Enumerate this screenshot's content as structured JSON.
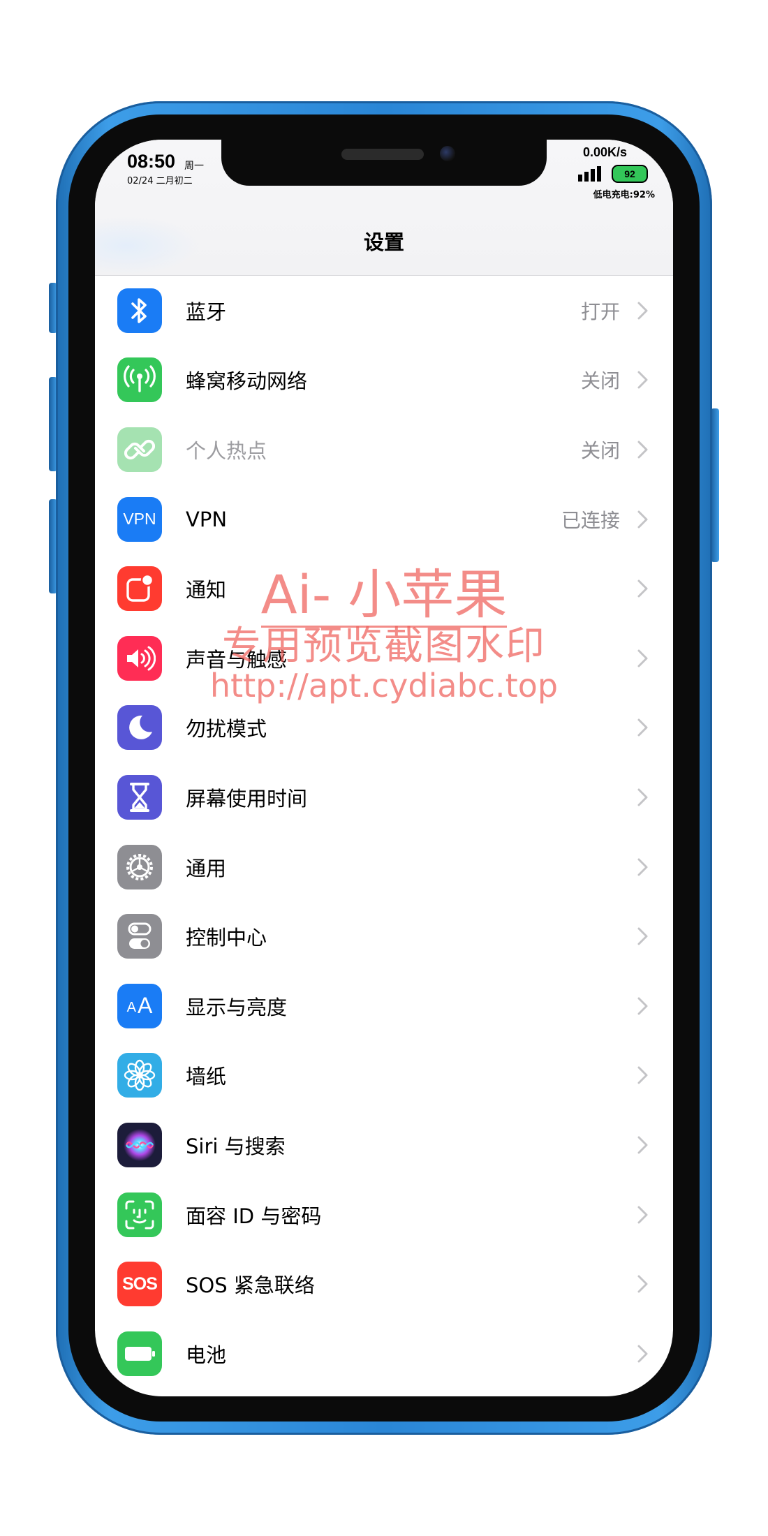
{
  "status_bar": {
    "time": "08:50",
    "weekday": "周一",
    "date": "02/24 二月初二",
    "net_speed": "0.00K/s",
    "battery_level": "92",
    "low_power_label": "低电充电:92%"
  },
  "nav": {
    "title": "设置"
  },
  "settings": [
    {
      "label": "蓝牙",
      "value": "打开",
      "icon": "bluetooth-icon",
      "color": "#1a7cf5"
    },
    {
      "label": "蜂窝移动网络",
      "value": "关闭",
      "icon": "cellular-antenna-icon",
      "color": "#34c759"
    },
    {
      "label": "个人热点",
      "value": "关闭",
      "icon": "hotspot-chain-icon",
      "color": "#a5e2b1",
      "dim": true
    },
    {
      "label": "VPN",
      "value": "已连接",
      "icon": "vpn-icon",
      "color": "#1a7cf5"
    },
    {
      "label": "通知",
      "value": "",
      "icon": "notification-icon",
      "color": "#ff3b30"
    },
    {
      "label": "声音与触感",
      "value": "",
      "icon": "speaker-icon",
      "color": "#ff2d55"
    },
    {
      "label": "勿扰模式",
      "value": "",
      "icon": "moon-icon",
      "color": "#5856d6"
    },
    {
      "label": "屏幕使用时间",
      "value": "",
      "icon": "hourglass-icon",
      "color": "#5856d6"
    },
    {
      "label": "通用",
      "value": "",
      "icon": "gear-icon",
      "color": "#8e8e93"
    },
    {
      "label": "控制中心",
      "value": "",
      "icon": "toggles-icon",
      "color": "#8e8e93"
    },
    {
      "label": "显示与亮度",
      "value": "",
      "icon": "text-size-icon",
      "color": "#1a7cf5"
    },
    {
      "label": "墙纸",
      "value": "",
      "icon": "flower-icon",
      "color": "#32ade6"
    },
    {
      "label": "Siri 与搜索",
      "value": "",
      "icon": "siri-icon",
      "color": "#1c1c3a"
    },
    {
      "label": "面容 ID 与密码",
      "value": "",
      "icon": "face-id-icon",
      "color": "#34c759"
    },
    {
      "label": "SOS 紧急联络",
      "value": "",
      "icon": "sos-icon",
      "color": "#ff3b30"
    },
    {
      "label": "电池",
      "value": "",
      "icon": "battery-icon",
      "color": "#34c759"
    }
  ],
  "icon_text": {
    "vpn": "VPN",
    "sos": "SOS",
    "text_size_small": "A",
    "text_size_large": "A"
  },
  "watermark": {
    "line1": "Ai- 小苹果",
    "line2": "专用预览截图水印",
    "line3": "http://apt.cydiabc.top"
  }
}
